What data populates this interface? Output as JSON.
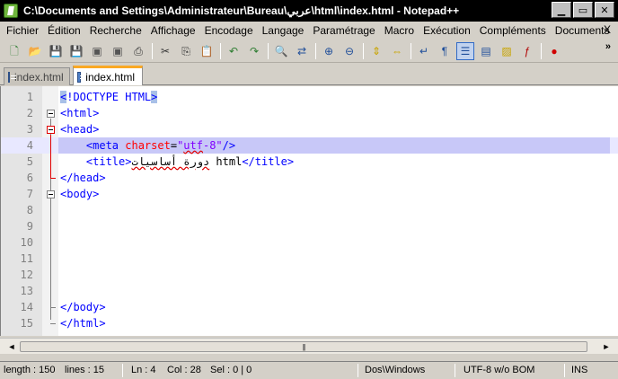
{
  "window": {
    "title": "C:\\Documents and Settings\\Administrateur\\Bureau\\عربي\\html\\index.html - Notepad++",
    "controls": [
      "▁",
      "▭",
      "✕"
    ]
  },
  "menu": {
    "items": [
      "Fichier",
      "Édition",
      "Recherche",
      "Affichage",
      "Encodage",
      "Langage",
      "Paramétrage",
      "Macro",
      "Exécution",
      "Compléments",
      "Documents",
      "?"
    ],
    "close_label": "X"
  },
  "toolbar": {
    "more_label": "»",
    "buttons": [
      {
        "icon": "new-file-icon",
        "glyph": "🗋",
        "color": "#2e7d32"
      },
      {
        "icon": "open-file-icon",
        "glyph": "📂",
        "color": "#c8a400"
      },
      {
        "icon": "save-icon",
        "glyph": "💾",
        "color": "#1f4e9a"
      },
      {
        "icon": "save-all-icon",
        "glyph": "💾",
        "color": "#1f4e9a"
      },
      {
        "icon": "close-file-icon",
        "glyph": "▣",
        "color": "#555555"
      },
      {
        "icon": "close-all-icon",
        "glyph": "▣",
        "color": "#555555"
      },
      {
        "icon": "print-icon",
        "glyph": "⎙",
        "color": "#333333"
      },
      {
        "sep": true
      },
      {
        "icon": "cut-icon",
        "glyph": "✂",
        "color": "#333333"
      },
      {
        "icon": "copy-icon",
        "glyph": "⎘",
        "color": "#333333"
      },
      {
        "icon": "paste-icon",
        "glyph": "📋",
        "color": "#b07a2a"
      },
      {
        "sep": true
      },
      {
        "icon": "undo-icon",
        "glyph": "↶",
        "color": "#2e7d32"
      },
      {
        "icon": "redo-icon",
        "glyph": "↷",
        "color": "#2e7d32"
      },
      {
        "sep": true
      },
      {
        "icon": "find-icon",
        "glyph": "🔍",
        "color": "#333333"
      },
      {
        "icon": "replace-icon",
        "glyph": "⇄",
        "color": "#1f4e9a"
      },
      {
        "sep": true
      },
      {
        "icon": "zoom-in-icon",
        "glyph": "⊕",
        "color": "#1f4e9a"
      },
      {
        "icon": "zoom-out-icon",
        "glyph": "⊖",
        "color": "#1f4e9a"
      },
      {
        "sep": true
      },
      {
        "icon": "sync-vertical-icon",
        "glyph": "⇕",
        "color": "#c8a400"
      },
      {
        "icon": "sync-horizontal-icon",
        "glyph": "⇔",
        "color": "#c8a400"
      },
      {
        "sep": true
      },
      {
        "icon": "word-wrap-icon",
        "glyph": "↵",
        "color": "#1f4e9a"
      },
      {
        "icon": "show-all-chars-icon",
        "glyph": "¶",
        "color": "#1f4e9a"
      },
      {
        "icon": "indent-guide-icon",
        "glyph": "☰",
        "color": "#1f4e9a",
        "active": true
      },
      {
        "icon": "user-language-icon",
        "glyph": "▤",
        "color": "#1f4e9a"
      },
      {
        "icon": "document-map-icon",
        "glyph": "▨",
        "color": "#c8a400"
      },
      {
        "icon": "function-list-icon",
        "glyph": "ƒ",
        "color": "#b00000"
      },
      {
        "sep": true
      },
      {
        "icon": "record-macro-icon",
        "glyph": "●",
        "color": "#d00000"
      }
    ]
  },
  "tabs": [
    {
      "label": "index.html",
      "active": false
    },
    {
      "label": "index.html",
      "active": true
    }
  ],
  "editor": {
    "current_line": 4,
    "lines": [
      {
        "n": "1",
        "parts": [
          {
            "t": "<",
            "c": "tag hl"
          },
          {
            "t": "!DOCTYPE HTML",
            "c": "tag"
          },
          {
            "t": ">",
            "c": "tag hl"
          }
        ]
      },
      {
        "n": "2",
        "parts": [
          {
            "t": "<html>",
            "c": "tag"
          }
        ]
      },
      {
        "n": "3",
        "parts": [
          {
            "t": "<head>",
            "c": "tag"
          }
        ]
      },
      {
        "n": "4",
        "parts": [
          {
            "t": "    <meta ",
            "c": "tag"
          },
          {
            "t": "charset",
            "c": "attr"
          },
          {
            "t": "=",
            "c": "txt"
          },
          {
            "t": "\"",
            "c": "val"
          },
          {
            "t": "utf",
            "c": "val squiggle"
          },
          {
            "t": "-8\"",
            "c": "val"
          },
          {
            "t": "/>",
            "c": "tag"
          }
        ]
      },
      {
        "n": "5",
        "parts": [
          {
            "t": "    <title>",
            "c": "tag"
          },
          {
            "t": "دورة أساسيات",
            "c": "txt squiggle"
          },
          {
            "t": " html",
            "c": "txt"
          },
          {
            "t": "</title>",
            "c": "tag"
          }
        ]
      },
      {
        "n": "6",
        "parts": [
          {
            "t": "</head>",
            "c": "tag"
          }
        ]
      },
      {
        "n": "7",
        "parts": [
          {
            "t": "<body>",
            "c": "tag"
          }
        ]
      },
      {
        "n": "8",
        "parts": []
      },
      {
        "n": "9",
        "parts": []
      },
      {
        "n": "10",
        "parts": []
      },
      {
        "n": "11",
        "parts": []
      },
      {
        "n": "12",
        "parts": []
      },
      {
        "n": "13",
        "parts": []
      },
      {
        "n": "14",
        "parts": [
          {
            "t": "</body>",
            "c": "tag"
          }
        ]
      },
      {
        "n": "15",
        "parts": [
          {
            "t": "</html>",
            "c": "tag"
          }
        ]
      }
    ]
  },
  "scrollbar": {
    "left_arrow": "◄",
    "right_arrow": "►",
    "grip": "|||"
  },
  "status": {
    "length": "length : 150",
    "lines": "lines : 15",
    "ln": "Ln : 4",
    "col": "Col : 28",
    "sel": "Sel : 0 | 0",
    "eol": "Dos\\Windows",
    "encoding": "UTF-8 w/o BOM",
    "mode": "INS"
  }
}
